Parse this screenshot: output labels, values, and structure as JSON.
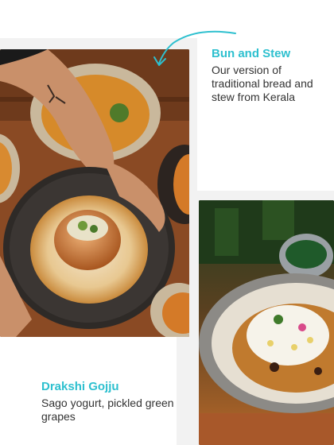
{
  "dishes": [
    {
      "name": "Bun and Stew",
      "description": "Our version of traditional bread and stew from Kerala"
    },
    {
      "name": "Drakshi Gojju",
      "description": "Sago yogurt, pickled green grapes"
    }
  ],
  "colors": {
    "accent": "#2ec0cf",
    "text": "#333333",
    "panel": "#f2f2f2"
  },
  "icons": [
    "curved-arrow-icon"
  ]
}
